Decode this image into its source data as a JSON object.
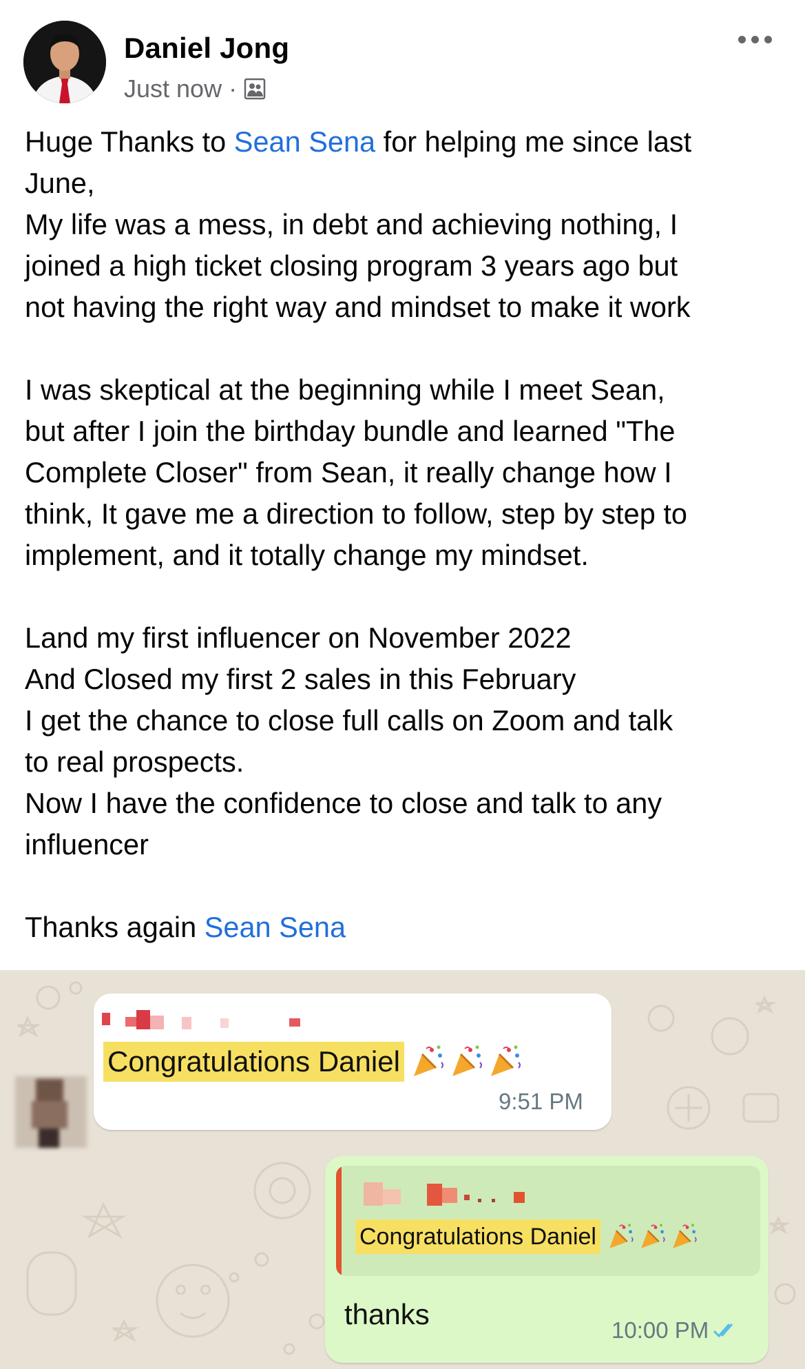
{
  "post": {
    "author": "Daniel Jong",
    "timestamp": "Just now",
    "separator": "·",
    "audience_icon": "friends-icon",
    "more_icon": "more-options-icon",
    "paragraphs": [
      {
        "lines": [
          [
            "Huge Thanks to ",
            {
              "mention": "Sean Sena"
            },
            " for helping me since last"
          ],
          [
            "June,"
          ],
          [
            "My life was a mess, in debt and achieving nothing, I"
          ],
          [
            "joined a high ticket closing program 3 years ago but"
          ],
          [
            "not having the right way and mindset to make it work"
          ]
        ]
      },
      {
        "lines": [
          [
            "I was skeptical at the beginning while I meet Sean,"
          ],
          [
            "but after I join the birthday bundle and learned \"The"
          ],
          [
            "Complete Closer\" from Sean, it really change how I"
          ],
          [
            "think, It gave me a direction to follow, step by step to"
          ],
          [
            "implement, and it totally change my mindset."
          ]
        ]
      },
      {
        "lines": [
          [
            "Land my first influencer on November 2022"
          ],
          [
            "And Closed my first 2 sales in this February"
          ],
          [
            "I get the chance to close full calls on Zoom and talk"
          ],
          [
            "to real prospects."
          ],
          [
            "Now I have the confidence to close and talk to any"
          ],
          [
            "influencer"
          ]
        ]
      },
      {
        "lines": [
          [
            "Thanks again ",
            {
              "mention": "Sean Sena"
            }
          ]
        ]
      }
    ]
  },
  "chat": {
    "incoming": {
      "text": "Congratulations Daniel",
      "emoji": "party-popper-icon",
      "time": "9:51 PM"
    },
    "outgoing": {
      "quoted_text": "Congratulations Daniel",
      "reply": "thanks",
      "time": "10:00 PM",
      "status_icon": "double-check-icon"
    }
  },
  "colors": {
    "mention": "#216fdb",
    "muted": "#65676b",
    "highlight": "#f7df62",
    "chat_background": "#e8e1d6",
    "outgoing_bubble": "#dcf8c6",
    "quote_bar": "#e0542f",
    "read_ticks": "#53bdeb"
  }
}
